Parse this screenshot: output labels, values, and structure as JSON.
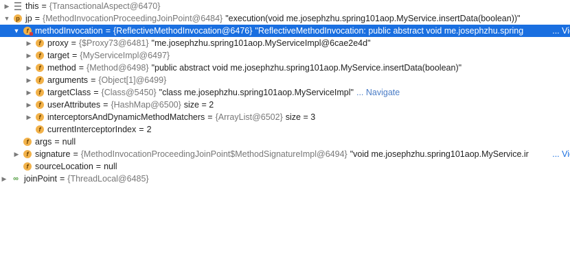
{
  "rows": [
    {
      "arrow": "▶",
      "icon": "stack",
      "name": "this",
      "type": "{TransactionalAspect@6470}",
      "str": "",
      "extra": "",
      "link": "",
      "view": ""
    },
    {
      "arrow": "▼",
      "icon": "p",
      "name": "jp",
      "type": "{MethodInvocationProceedingJoinPoint@6484}",
      "str": "\"execution(void me.josephzhu.spring101aop.MyService.insertData(boolean))\"",
      "extra": "",
      "link": "",
      "view": ""
    },
    {
      "arrow": "▼",
      "icon": "lock",
      "name": "methodInvocation",
      "type": "{ReflectiveMethodInvocation@6476}",
      "str": "\"ReflectiveMethodInvocation: public abstract void me.josephzhu.spring",
      "extra": "",
      "link": "...",
      "view": "View"
    },
    {
      "arrow": "▶",
      "icon": "f",
      "name": "proxy",
      "type": "{$Proxy73@6481}",
      "str": "\"me.josephzhu.spring101aop.MyServiceImpl@6cae2e4d\"",
      "extra": "",
      "link": "",
      "view": ""
    },
    {
      "arrow": "▶",
      "icon": "f",
      "name": "target",
      "type": "{MyServiceImpl@6497}",
      "str": "",
      "extra": "",
      "link": "",
      "view": ""
    },
    {
      "arrow": "▶",
      "icon": "f",
      "name": "method",
      "type": "{Method@6498}",
      "str": "\"public abstract void me.josephzhu.spring101aop.MyService.insertData(boolean)\"",
      "extra": "",
      "link": "",
      "view": ""
    },
    {
      "arrow": "▶",
      "icon": "f",
      "name": "arguments",
      "type": "{Object[1]@6499}",
      "str": "",
      "extra": "",
      "link": "",
      "view": ""
    },
    {
      "arrow": "▶",
      "icon": "f",
      "name": "targetClass",
      "type": "{Class@5450}",
      "str": "\"class me.josephzhu.spring101aop.MyServiceImpl\"",
      "extra": "",
      "link": "... Navigate",
      "view": ""
    },
    {
      "arrow": "▶",
      "icon": "f",
      "name": "userAttributes",
      "type": "{HashMap@6500}",
      "str": "",
      "extra": "size = 2",
      "link": "",
      "view": ""
    },
    {
      "arrow": "▶",
      "icon": "f",
      "name": "interceptorsAndDynamicMethodMatchers",
      "type": "{ArrayList@6502}",
      "str": "",
      "extra": "size = 3",
      "link": "",
      "view": ""
    },
    {
      "arrow": "",
      "icon": "f",
      "name": "currentInterceptorIndex",
      "type": "2",
      "str": "",
      "extra": "",
      "link": "",
      "view": ""
    },
    {
      "arrow": "",
      "icon": "f",
      "name": "args",
      "type": "null",
      "str": "",
      "extra": "",
      "link": "",
      "view": ""
    },
    {
      "arrow": "▶",
      "icon": "f",
      "name": "signature",
      "type": "{MethodInvocationProceedingJoinPoint$MethodSignatureImpl@6494}",
      "str": "\"void me.josephzhu.spring101aop.MyService.ir",
      "extra": "",
      "link": "...",
      "view": "View"
    },
    {
      "arrow": "",
      "icon": "f",
      "name": "sourceLocation",
      "type": "null",
      "str": "",
      "extra": "",
      "link": "",
      "view": ""
    },
    {
      "arrow": "▶",
      "icon": "watch",
      "name": "joinPoint",
      "type": "{ThreadLocal@6485}",
      "str": "",
      "extra": "",
      "link": "",
      "view": ""
    }
  ],
  "icons": {
    "f": "f",
    "p": "p",
    "watch": "∞"
  }
}
